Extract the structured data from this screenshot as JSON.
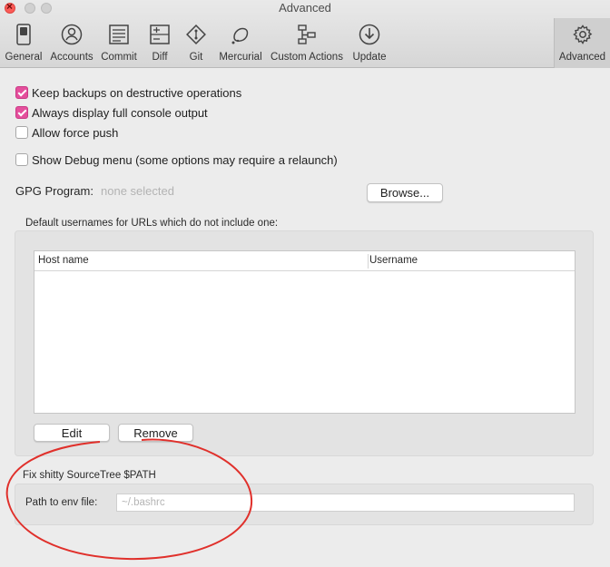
{
  "window": {
    "title": "Advanced"
  },
  "toolbar": {
    "items": [
      {
        "label": "General",
        "icon": "switch-icon"
      },
      {
        "label": "Accounts",
        "icon": "user-icon"
      },
      {
        "label": "Commit",
        "icon": "document-icon"
      },
      {
        "label": "Diff",
        "icon": "diff-icon"
      },
      {
        "label": "Git",
        "icon": "git-icon"
      },
      {
        "label": "Mercurial",
        "icon": "mercurial-icon"
      },
      {
        "label": "Custom Actions",
        "icon": "custom-actions-icon"
      },
      {
        "label": "Update",
        "icon": "update-icon"
      },
      {
        "label": "Advanced",
        "icon": "gear-icon"
      }
    ]
  },
  "options": {
    "keep_backups": {
      "label": "Keep backups on destructive operations",
      "checked": true
    },
    "full_console": {
      "label": "Always display full console output",
      "checked": true
    },
    "force_push": {
      "label": "Allow force push",
      "checked": false
    },
    "debug_menu": {
      "label": "Show Debug menu (some options may require a relaunch)",
      "checked": false
    }
  },
  "gpg": {
    "label": "GPG Program:",
    "value": "none selected",
    "browse_label": "Browse..."
  },
  "usernames": {
    "caption": "Default usernames for URLs which do not include one:",
    "columns": [
      "Host name",
      "Username"
    ],
    "rows": [],
    "edit_label": "Edit",
    "remove_label": "Remove"
  },
  "path_fix": {
    "caption": "Fix shitty SourceTree $PATH",
    "label": "Path to env file:",
    "placeholder": "~/.bashrc",
    "value": ""
  },
  "colors": {
    "checkbox_accent": "#e44f9c",
    "annotation": "#e0302b"
  }
}
